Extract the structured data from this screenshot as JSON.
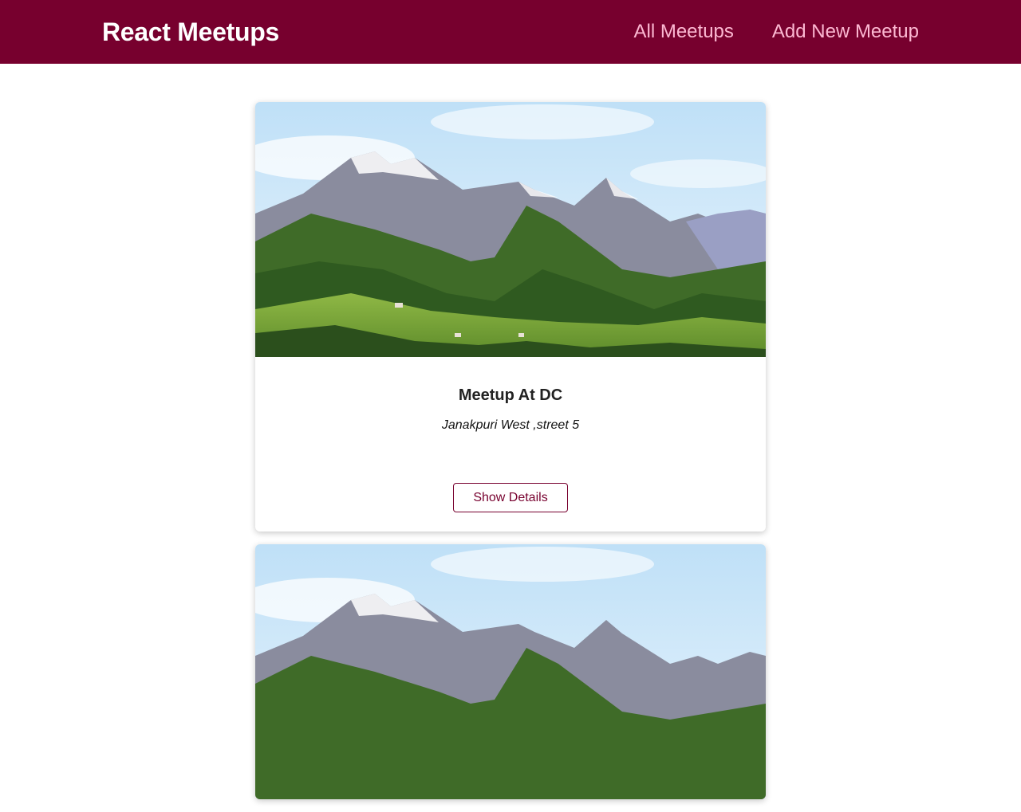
{
  "header": {
    "title": "React Meetups",
    "nav": [
      {
        "label": "All Meetups"
      },
      {
        "label": "Add New Meetup"
      }
    ]
  },
  "colors": {
    "brand": "#77002e",
    "nav_link": "#fcb8d2",
    "card_bg": "#ffffff"
  },
  "meetups": [
    {
      "image": "mountain-landscape",
      "title": "Meetup At DC",
      "address": "Janakpuri West ,street 5",
      "button_label": "Show Details"
    },
    {
      "image": "mountain-landscape"
    }
  ]
}
